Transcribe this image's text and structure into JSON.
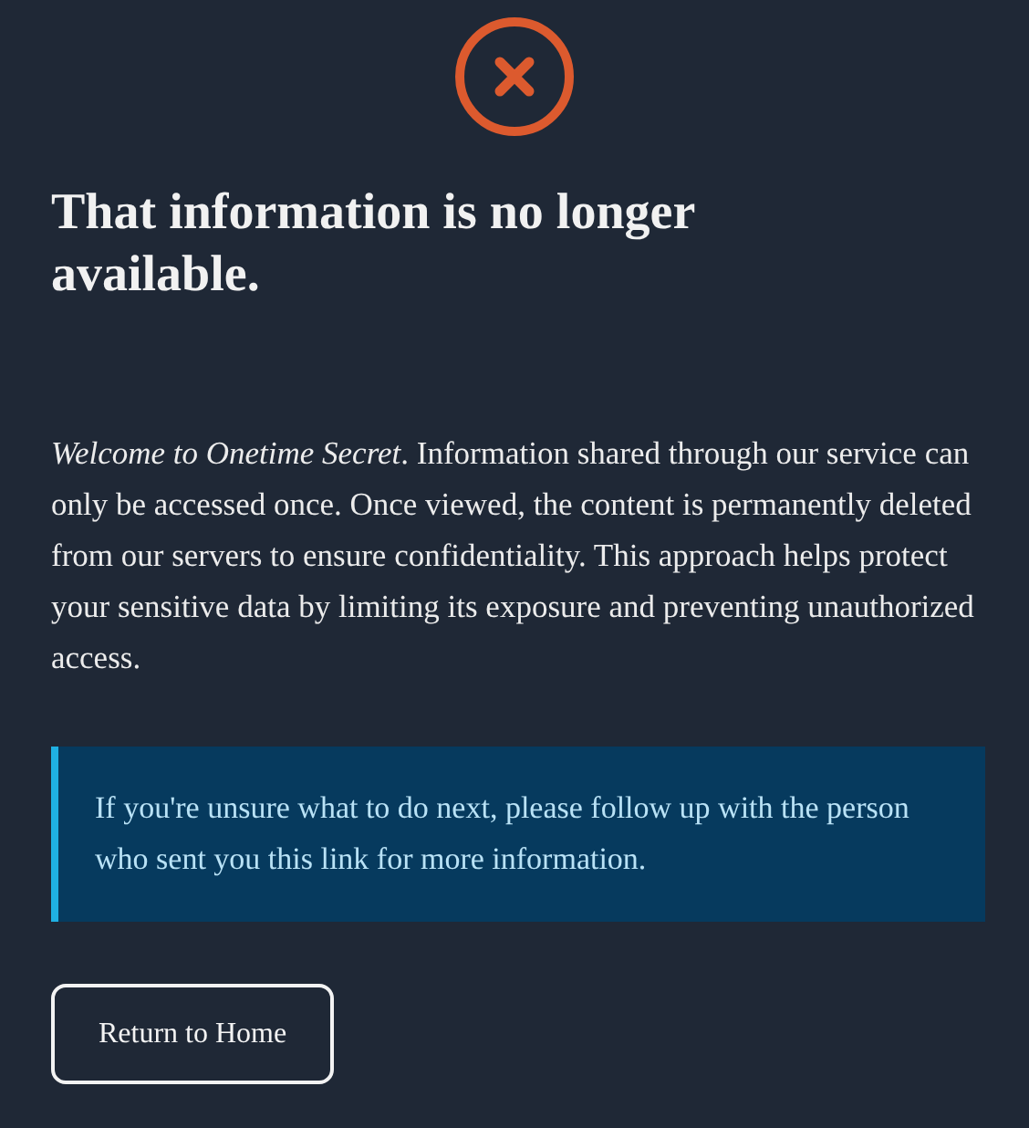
{
  "status_icon": {
    "kind": "error"
  },
  "heading": "That information is no longer available.",
  "description": "*Welcome to Onetime Secret*. Information shared through our service can only be accessed once. Once viewed, the content is permanently deleted from our servers to ensure confidentiality. This approach helps protect your sensitive data by limiting its exposure and preventing unauthorized access.",
  "notice": "If you're unsure what to do next, please follow up with the person who sent you this link for more information.",
  "button": "Return to Home"
}
